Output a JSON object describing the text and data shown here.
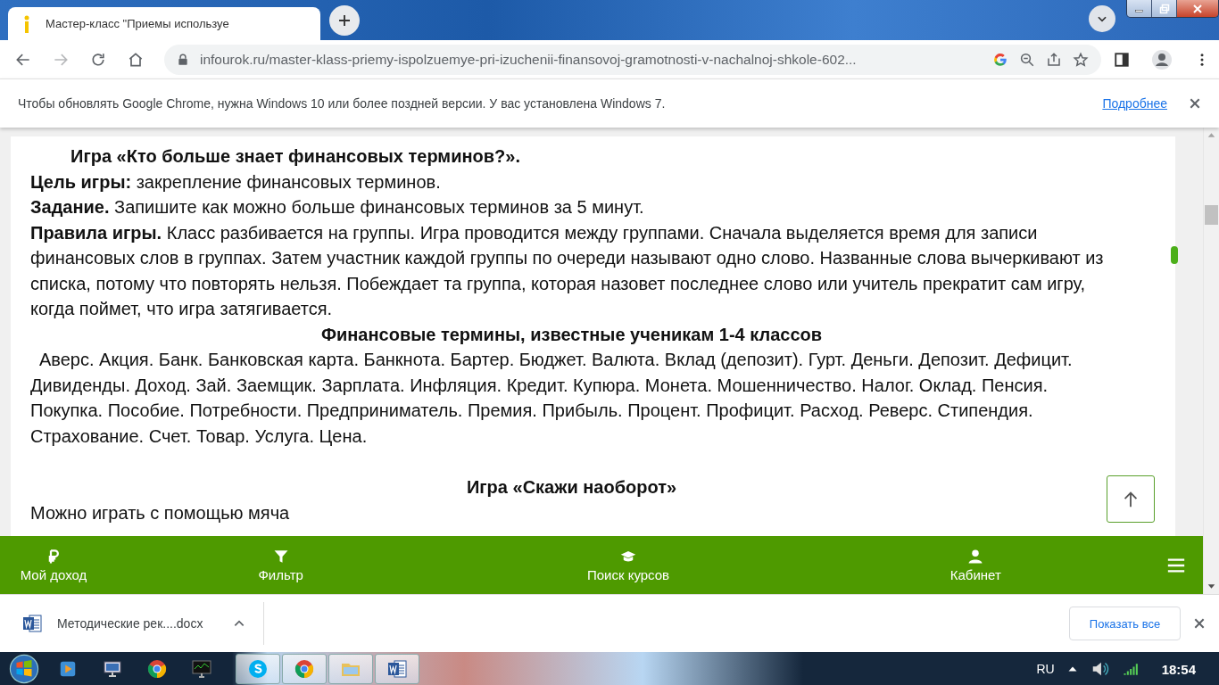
{
  "tab": {
    "title": "Мастер-класс \"Приемы используе",
    "selected": true
  },
  "nav_buttons": [
    {
      "kind": "back",
      "disabled": false
    },
    {
      "kind": "forward",
      "disabled": true
    },
    {
      "kind": "reload",
      "disabled": false
    },
    {
      "kind": "home",
      "disabled": false
    }
  ],
  "address_bar": {
    "url": "infourok.ru/master-klass-priemy-ispolzuemye-pri-izuchenii-finansovoj-gramotnosti-v-nachalnoj-shkole-602..."
  },
  "infobar": {
    "message": "Чтобы обновлять Google Chrome, нужна Windows 10 или более поздней версии. У вас установлена Windows 7.",
    "link": "Подробнее"
  },
  "article": [
    {
      "kind": "title",
      "text": "Игра «Кто больше знает финансовых терминов?»."
    },
    {
      "kind": "para",
      "text": "**Цель игры:** закрепление финансовых терминов."
    },
    {
      "kind": "para",
      "text": "**Задание.** Запишите как можно больше финансовых терминов за 5 минут."
    },
    {
      "kind": "para",
      "text": "**Правила игры.** Класс разбивается на группы. Игра проводится между группами. Сначала выделяется время для записи финансовых слов в группах. Затем участник каждой группы по очереди называют одно слово. Названные слова вычеркивают из списка, потому что повторять нельзя. Побеждает та группа, которая назовет последнее слово или учитель прекратит сам игру, когда поймет, что игра затягивается."
    },
    {
      "kind": "heading",
      "text": "Финансовые термины, известные ученикам 1-4 классов"
    },
    {
      "kind": "indented",
      "text": "Аверс. Акция. Банк. Банковская карта. Банкнота. Бартер. Бюджет. Валюта. Вклад (депозит). Гурт. Деньги. Депозит. Дефицит. Дивиденды. Доход. Зай. Заемщик. Зарплата. Инфляция. Кредит. Купюра. Монета. Мошенничество. Налог. Оклад. Пенсия. Покупка. Пособие. Потребности. Предприниматель. Премия. Прибыль. Процент. Профицит. Расход. Реверс. Стипендия. Страхование. Счет. Товар. Услуга. Цена."
    },
    {
      "kind": "spacer"
    },
    {
      "kind": "heading",
      "text": "Игра «Скажи наоборот»"
    },
    {
      "kind": "para",
      "text": "Можно играть с помощью мяча"
    }
  ],
  "site_nav": [
    {
      "kind": "ruble",
      "label": "Мой доход"
    },
    {
      "kind": "filter",
      "label": "Фильтр"
    },
    {
      "kind": "cap",
      "label": "Поиск курсов"
    },
    {
      "kind": "person",
      "label": "Кабинет"
    },
    {
      "kind": "menu"
    }
  ],
  "downloads": {
    "file": "Методические рек....docx",
    "show_all": "Показать все"
  },
  "taskbar": {
    "pinned": [
      {
        "kind": "media"
      },
      {
        "kind": "network"
      },
      {
        "kind": "chrome"
      },
      {
        "kind": "monitor"
      }
    ],
    "running": [
      {
        "kind": "skype"
      },
      {
        "kind": "chrome"
      },
      {
        "kind": "folder"
      },
      {
        "kind": "word"
      }
    ],
    "language": "RU",
    "time": "18:54"
  }
}
